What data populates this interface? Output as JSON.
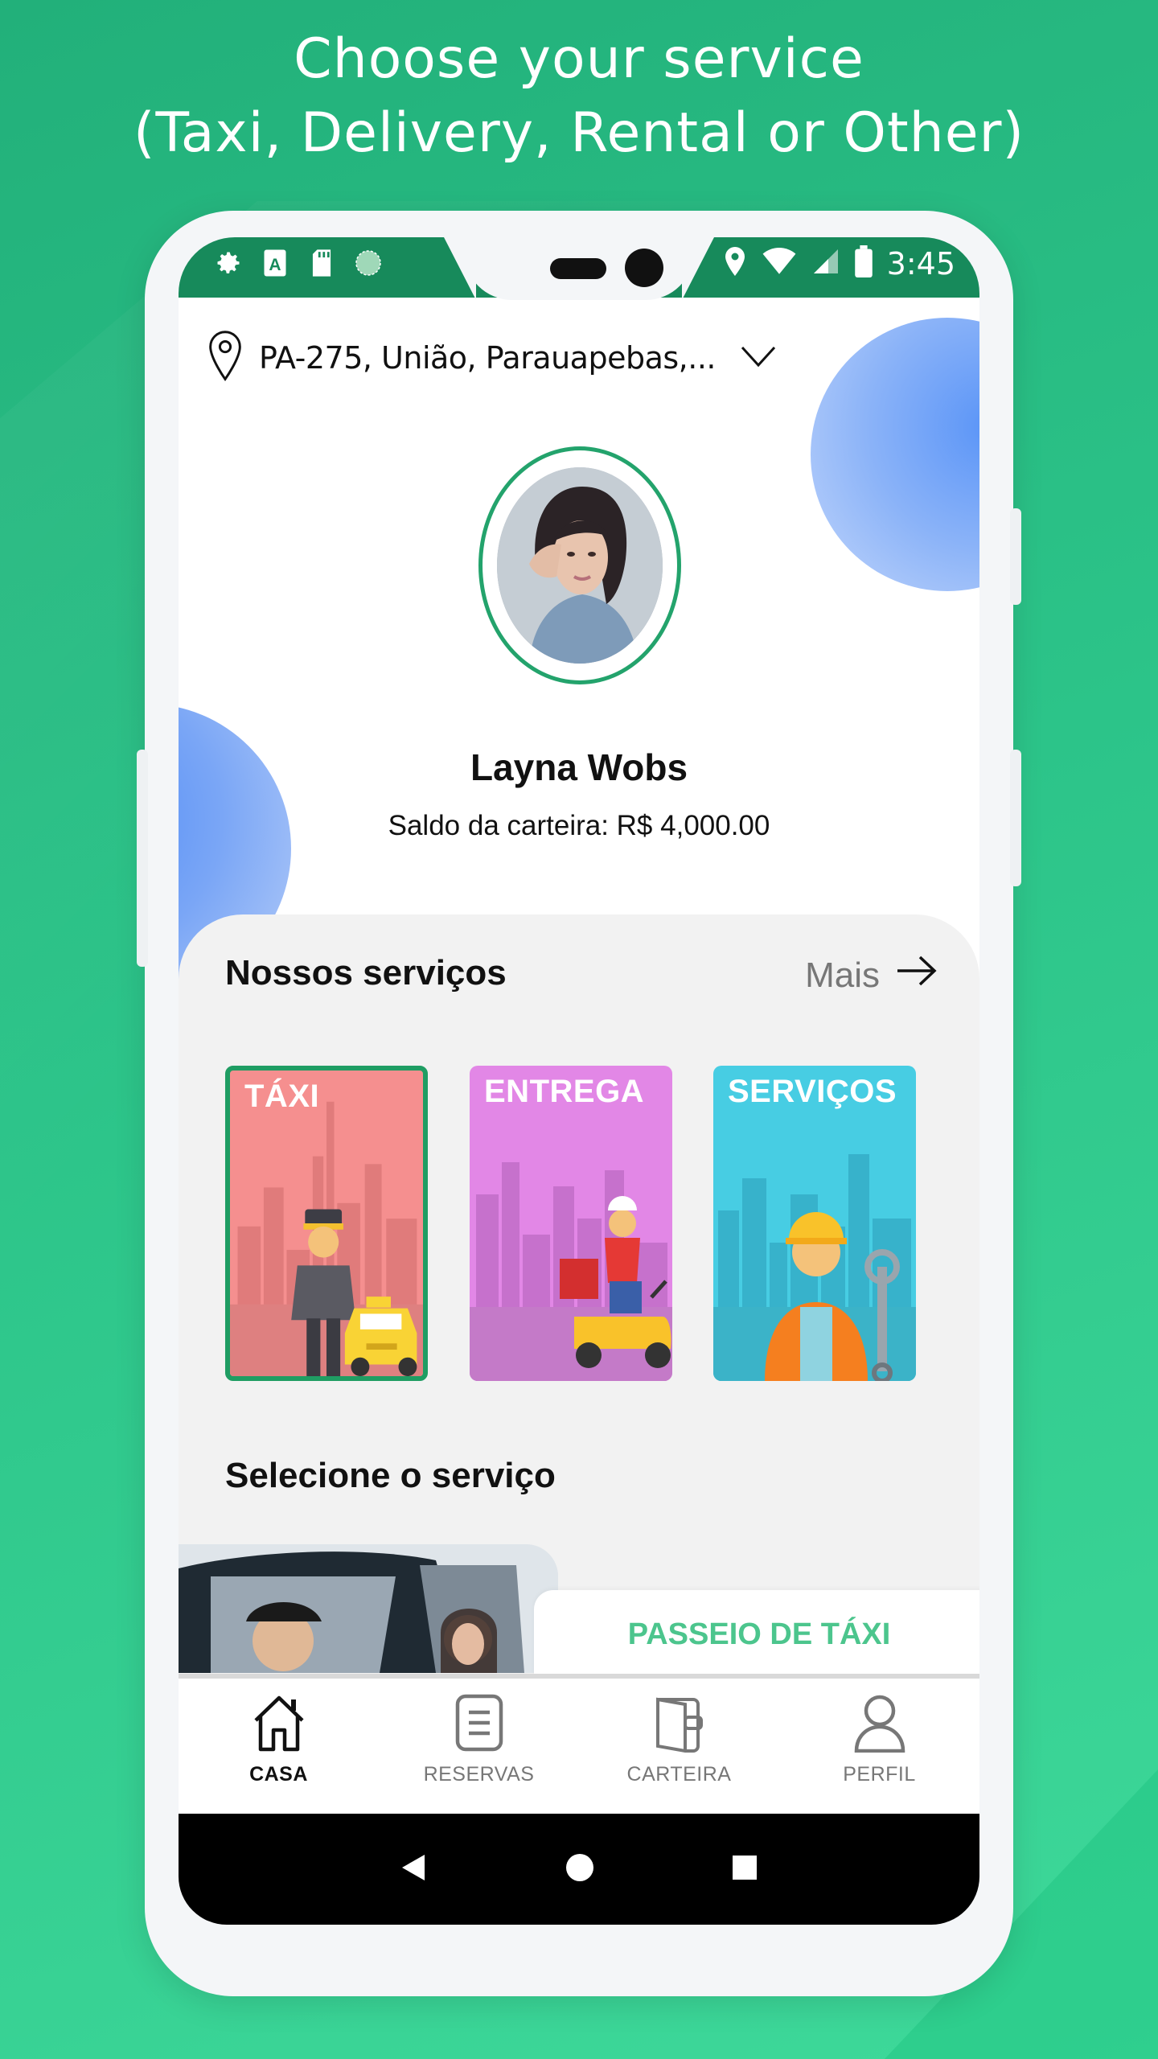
{
  "headline": {
    "line1": "Choose your service",
    "line2": "(Taxi, Delivery, Rental or Other)"
  },
  "status_bar": {
    "time": "3:45",
    "icons_left": [
      "gear-icon",
      "a-icon",
      "sd-card-icon",
      "globe-icon"
    ],
    "icons_right": [
      "location-pin-icon",
      "wifi-icon",
      "signal-icon",
      "battery-icon"
    ]
  },
  "location": {
    "address": "PA-275, União, Parauapebas,..."
  },
  "profile": {
    "name": "Layna Wobs",
    "wallet_balance": "Saldo da carteira: R$ 4,000.00"
  },
  "services": {
    "title": "Nossos serviços",
    "more_label": "Mais",
    "cards": [
      {
        "label": "TÁXI",
        "selected": true
      },
      {
        "label": "ENTREGA",
        "selected": false
      },
      {
        "label": "SERVIÇOS",
        "selected": false
      }
    ]
  },
  "select_service": {
    "title": "Selecione o serviço",
    "booking_label": "PASSEIO DE TÁXI"
  },
  "bottom_nav": {
    "items": [
      {
        "label": "CASA",
        "icon": "home-icon",
        "active": true
      },
      {
        "label": "RESERVAS",
        "icon": "document-icon",
        "active": false
      },
      {
        "label": "CARTEIRA",
        "icon": "wallet-icon",
        "active": false
      },
      {
        "label": "PERFIL",
        "icon": "user-icon",
        "active": false
      }
    ]
  },
  "colors": {
    "brand_green": "#178a5b",
    "accent_green": "#4cc58d",
    "taxi_card": "#f58f8f",
    "entrega_card": "#e287e6",
    "servicos_card": "#47cde3"
  }
}
